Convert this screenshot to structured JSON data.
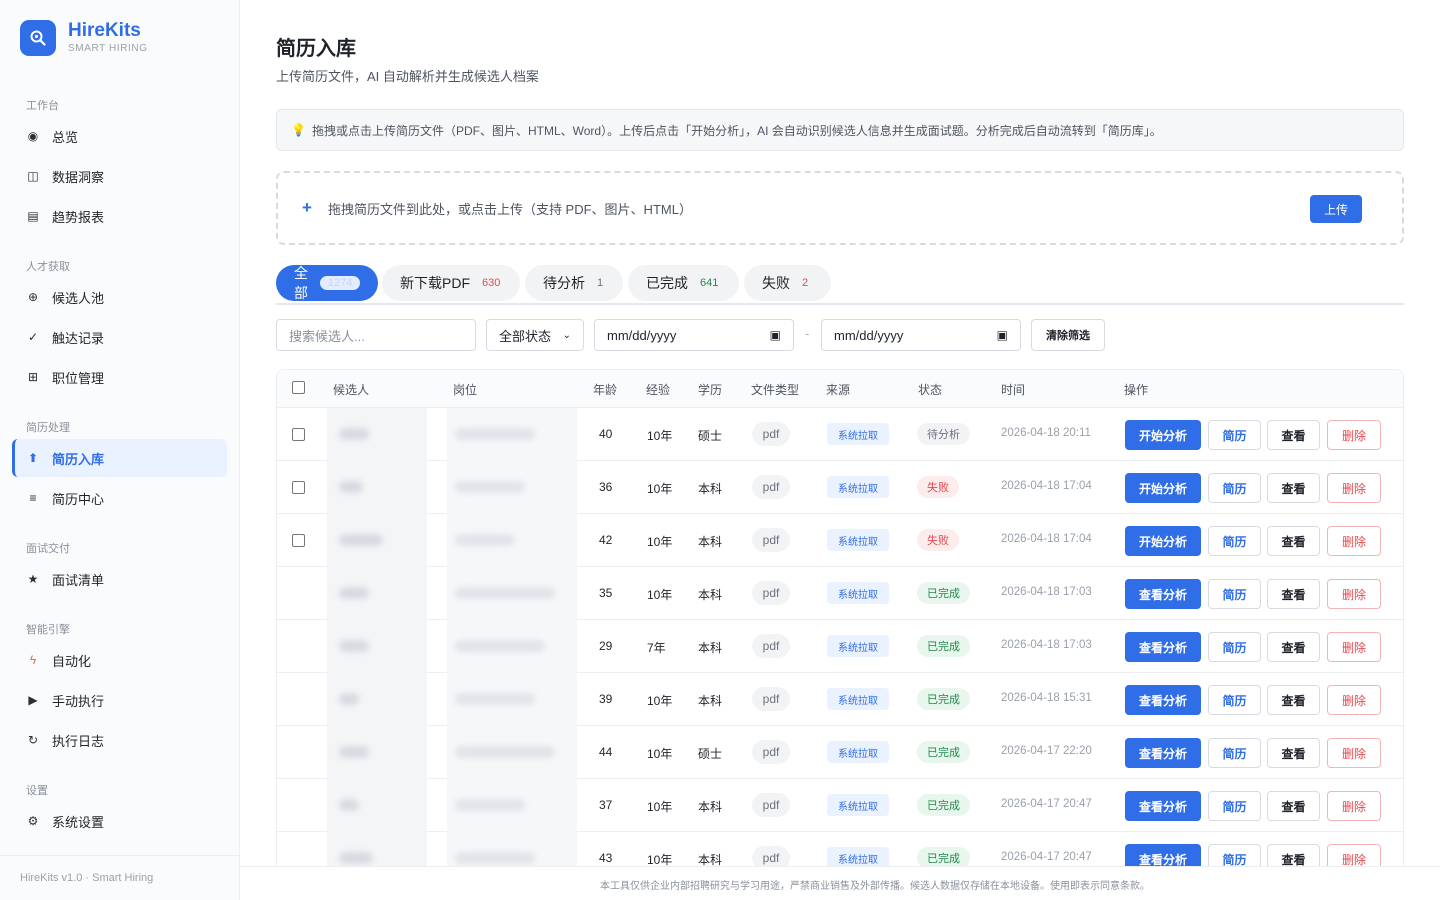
{
  "brand": {
    "name": "HireKits",
    "tagline": "SMART HIRING"
  },
  "sidebar": {
    "groups": [
      {
        "title": "工作台",
        "items": [
          {
            "label": "总览",
            "icon": "target-icon"
          },
          {
            "label": "数据洞察",
            "icon": "chart-icon"
          },
          {
            "label": "趋势报表",
            "icon": "report-icon"
          }
        ]
      },
      {
        "title": "人才获取",
        "items": [
          {
            "label": "候选人池",
            "icon": "pool-icon"
          },
          {
            "label": "触达记录",
            "icon": "check-icon"
          },
          {
            "label": "职位管理",
            "icon": "grid-icon"
          }
        ]
      },
      {
        "title": "简历处理",
        "items": [
          {
            "label": "简历入库",
            "icon": "upload-arrow-icon",
            "active": true
          },
          {
            "label": "简历中心",
            "icon": "list-icon"
          }
        ]
      },
      {
        "title": "面试交付",
        "items": [
          {
            "label": "面试清单",
            "icon": "star-icon"
          }
        ]
      },
      {
        "title": "智能引擎",
        "items": [
          {
            "label": "自动化",
            "icon": "lightning-icon"
          },
          {
            "label": "手动执行",
            "icon": "play-icon"
          },
          {
            "label": "执行日志",
            "icon": "refresh-icon"
          }
        ]
      },
      {
        "title": "设置",
        "items": [
          {
            "label": "系统设置",
            "icon": "gear-icon"
          }
        ]
      }
    ],
    "footer": "HireKits v1.0 · Smart Hiring"
  },
  "page": {
    "title": "简历入库",
    "subtitle": "上传简历文件，AI 自动解析并生成候选人档案",
    "tip": "拖拽或点击上传简历文件（PDF、图片、HTML、Word）。上传后点击「开始分析」，AI 会自动识别候选人信息并生成面试题。分析完成后自动流转到「简历库」。",
    "upload_text": "拖拽简历文件到此处，或点击上传（支持 PDF、图片、HTML）",
    "upload_button": "上传"
  },
  "tabs": [
    {
      "label": "全部",
      "count": "1274",
      "active": true,
      "count_color": "#c5d6f8"
    },
    {
      "label": "新下载PDF",
      "count": "630",
      "count_color": "#e5484d"
    },
    {
      "label": "待分析",
      "count": "1",
      "count_color": "#6b7280"
    },
    {
      "label": "已完成",
      "count": "641",
      "count_color": "#1f8a4c"
    },
    {
      "label": "失败",
      "count": "2",
      "count_color": "#e5484d"
    }
  ],
  "filters": {
    "search_placeholder": "搜索候选人...",
    "status_value": "全部状态",
    "date_from": "mm/dd/yyyy",
    "date_sep": "-",
    "date_to": "mm/dd/yyyy",
    "clear_label": "清除筛选"
  },
  "table": {
    "headers": {
      "candidate": "候选人",
      "position": "岗位",
      "age": "年龄",
      "experience": "经验",
      "education": "学历",
      "file_type": "文件类型",
      "source": "来源",
      "status": "状态",
      "time": "时间",
      "actions": "操作"
    },
    "rows": [
      {
        "checkbox": true,
        "age": "40",
        "exp": "10年",
        "edu": "硕士",
        "file": "pdf",
        "source": "系统拉取",
        "status": "待分析",
        "status_kind": "pending",
        "time": "2026-04-18 20:11",
        "primary": "开始分析"
      },
      {
        "checkbox": true,
        "age": "36",
        "exp": "10年",
        "edu": "本科",
        "file": "pdf",
        "source": "系统拉取",
        "status": "失败",
        "status_kind": "failed",
        "time": "2026-04-18 17:04",
        "primary": "开始分析"
      },
      {
        "checkbox": true,
        "age": "42",
        "exp": "10年",
        "edu": "本科",
        "file": "pdf",
        "source": "系统拉取",
        "status": "失败",
        "status_kind": "failed",
        "time": "2026-04-18 17:04",
        "primary": "开始分析"
      },
      {
        "checkbox": false,
        "age": "35",
        "exp": "10年",
        "edu": "本科",
        "file": "pdf",
        "source": "系统拉取",
        "status": "已完成",
        "status_kind": "done",
        "time": "2026-04-18 17:03",
        "primary": "查看分析"
      },
      {
        "checkbox": false,
        "age": "29",
        "exp": "7年",
        "edu": "本科",
        "file": "pdf",
        "source": "系统拉取",
        "status": "已完成",
        "status_kind": "done",
        "time": "2026-04-18 17:03",
        "primary": "查看分析"
      },
      {
        "checkbox": false,
        "age": "39",
        "exp": "10年",
        "edu": "本科",
        "file": "pdf",
        "source": "系统拉取",
        "status": "已完成",
        "status_kind": "done",
        "time": "2026-04-18 15:31",
        "primary": "查看分析"
      },
      {
        "checkbox": false,
        "age": "44",
        "exp": "10年",
        "edu": "硕士",
        "file": "pdf",
        "source": "系统拉取",
        "status": "已完成",
        "status_kind": "done",
        "time": "2026-04-17 22:20",
        "primary": "查看分析"
      },
      {
        "checkbox": false,
        "age": "37",
        "exp": "10年",
        "edu": "本科",
        "file": "pdf",
        "source": "系统拉取",
        "status": "已完成",
        "status_kind": "done",
        "time": "2026-04-17 20:47",
        "primary": "查看分析"
      },
      {
        "checkbox": false,
        "age": "43",
        "exp": "10年",
        "edu": "本科",
        "file": "pdf",
        "source": "系统拉取",
        "status": "已完成",
        "status_kind": "done",
        "time": "2026-04-17 20:47",
        "primary": "查看分析"
      }
    ],
    "action_labels": {
      "resume": "简历",
      "view": "查看",
      "delete": "删除"
    }
  },
  "bottom_note": "本工具仅供企业内部招聘研究与学习用途，严禁商业销售及外部传播。候选人数据仅存储在本地设备。使用即表示同意条款。",
  "colors": {
    "accent": "#2f6ee6",
    "danger": "#e5484d",
    "success": "#1f8a4c"
  }
}
